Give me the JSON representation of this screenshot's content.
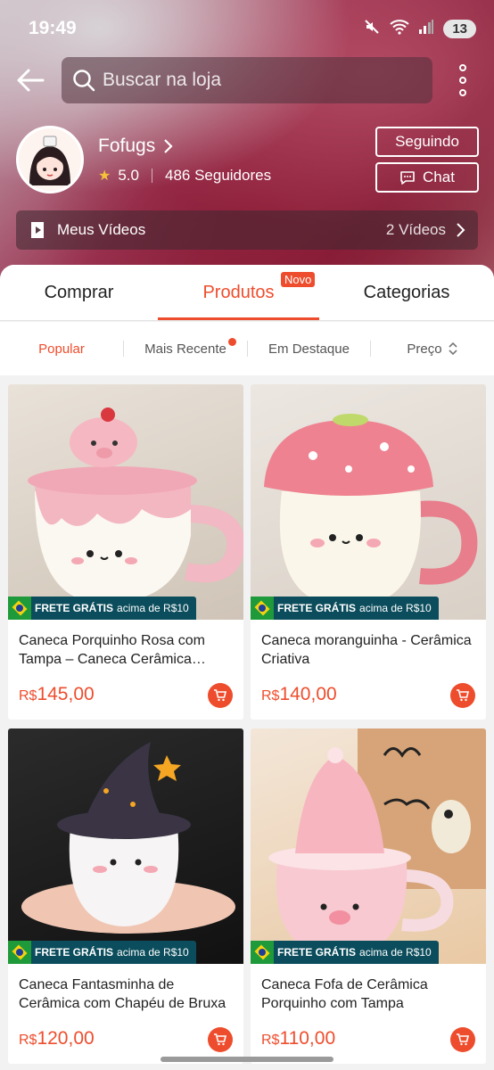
{
  "status": {
    "time": "19:49",
    "battery": "13",
    "network": "5"
  },
  "search": {
    "placeholder": "Buscar na loja"
  },
  "shop": {
    "name": "Fofugs",
    "rating": "5.0",
    "followers": "486 Seguidores",
    "follow_label": "Seguindo",
    "chat_label": "Chat"
  },
  "videos": {
    "label": "Meus Vídeos",
    "count": "2 Vídeos"
  },
  "tabs": [
    {
      "label": "Comprar"
    },
    {
      "label": "Produtos",
      "badge": "Novo",
      "active": true
    },
    {
      "label": "Categorias"
    }
  ],
  "sort": {
    "popular": "Popular",
    "recent": "Mais Recente",
    "featured": "Em Destaque",
    "price": "Preço"
  },
  "promo": {
    "strong": "FRETE GRÁTIS",
    "rest": "acima de R$10"
  },
  "products": [
    {
      "title": "Caneca Porquinho Rosa com Tampa – Caneca Cerâmica Criativa",
      "currency": "R$",
      "price": "145,00"
    },
    {
      "title": "Caneca moranguinha - Cerâmica Criativa",
      "currency": "R$",
      "price": "140,00"
    },
    {
      "title": "Caneca Fantasminha de Cerâmica com Chapéu de Bruxa",
      "currency": "R$",
      "price": "120,00"
    },
    {
      "title": "Caneca Fofa de Cerâmica Porquinho com Tampa",
      "currency": "R$",
      "price": "110,00"
    }
  ],
  "colors": {
    "accent": "#ee4d2d",
    "promo_bg": "#0b4d5c"
  }
}
